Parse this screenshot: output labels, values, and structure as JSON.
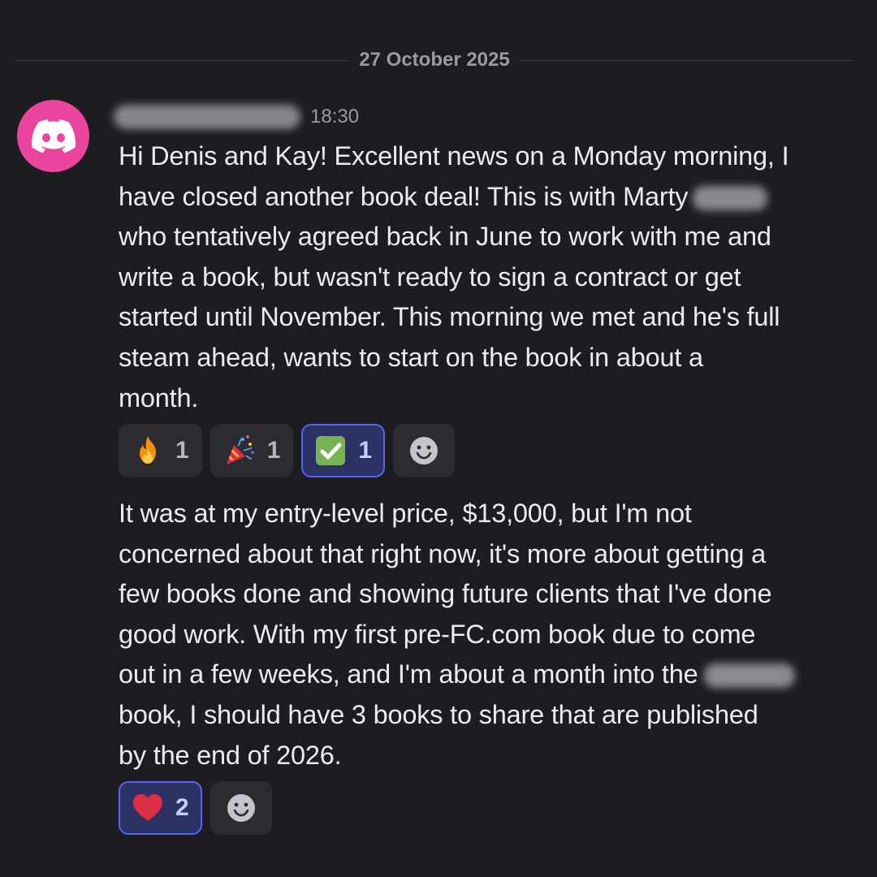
{
  "date_divider": "27 October 2025",
  "message": {
    "timestamp": "18:30",
    "paragraph1": [
      "Hi Denis and Kay! Excellent news on a Monday morning, I",
      "have closed another book deal! This is with Marty",
      "who tentatively agreed back in June to work with me and",
      "write a book, but wasn't ready to sign a contract or get",
      "started until November. This morning we met and he's full",
      "steam ahead, wants to start on the book in about a",
      "month."
    ],
    "reactions1": [
      {
        "emoji": "fire-emoji",
        "count": "1",
        "me": false
      },
      {
        "emoji": "party-popper-emoji",
        "count": "1",
        "me": false
      },
      {
        "emoji": "check-mark-button-emoji",
        "count": "1",
        "me": true
      }
    ],
    "paragraph2": [
      "It was at my entry-level price, $13,000, but I'm not",
      "concerned about that right now, it's more about getting a",
      "few books done and showing future clients that I've done",
      "good work. With my first pre-FC.com book due to come",
      "out in a few weeks, and I'm about a month into the",
      "book, I should have 3 books to share that are published",
      "by the end of 2026."
    ],
    "reactions2": [
      {
        "emoji": "red-heart-emoji",
        "count": "2",
        "me": true
      }
    ]
  },
  "colors": {
    "background": "#1c1c21",
    "avatar": "#eb459f",
    "reaction_active_border": "#5865f2"
  }
}
